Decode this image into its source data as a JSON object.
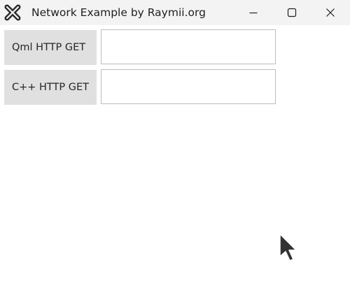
{
  "window": {
    "title": "Network Example by Raymii.org",
    "app_icon": "x-logo-icon",
    "controls": {
      "minimize_icon": "minimize-icon",
      "maximize_icon": "maximize-icon",
      "close_icon": "close-icon"
    }
  },
  "main": {
    "qml_button_label": "Qml HTTP GET",
    "cpp_button_label": "C++ HTTP GET",
    "qml_result_value": "",
    "cpp_result_value": ""
  },
  "colors": {
    "titlebar_bg": "#f3f3f3",
    "button_bg": "#e0e0e0",
    "field_border": "#bdbdbd",
    "cursor": "#333333"
  }
}
